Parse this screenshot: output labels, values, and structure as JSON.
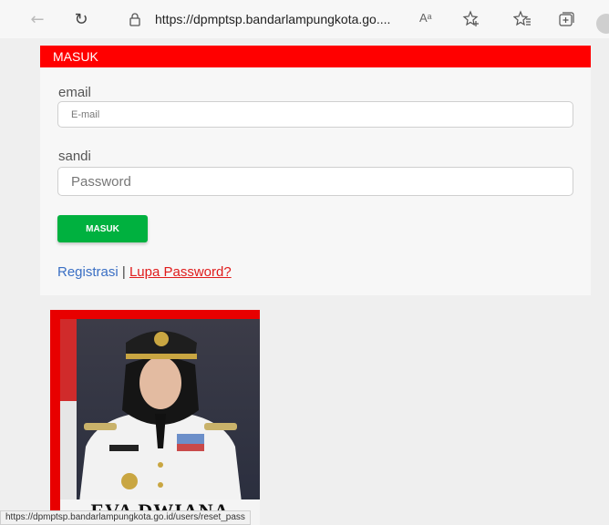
{
  "browser": {
    "url": "https://dpmptsp.bandarlampungkota.go....",
    "read_aloud_label": "Aᵃ",
    "status_url": "https://dpmptsp.bandarlampungkota.go.id/users/reset_pass"
  },
  "login": {
    "header": "MASUK",
    "email_label": "email",
    "email_placeholder": "E-mail",
    "password_label": "sandi",
    "password_placeholder": "Password",
    "submit_label": "MASUK",
    "register_link": "Registrasi",
    "separator": "|",
    "forgot_link": "Lupa Password?"
  },
  "banner": {
    "name": "EVA DWIANA"
  },
  "colors": {
    "header_red": "#ff0000",
    "button_green": "#00b13f",
    "link_blue": "#3a6fc4",
    "link_red": "#e01b1b"
  }
}
